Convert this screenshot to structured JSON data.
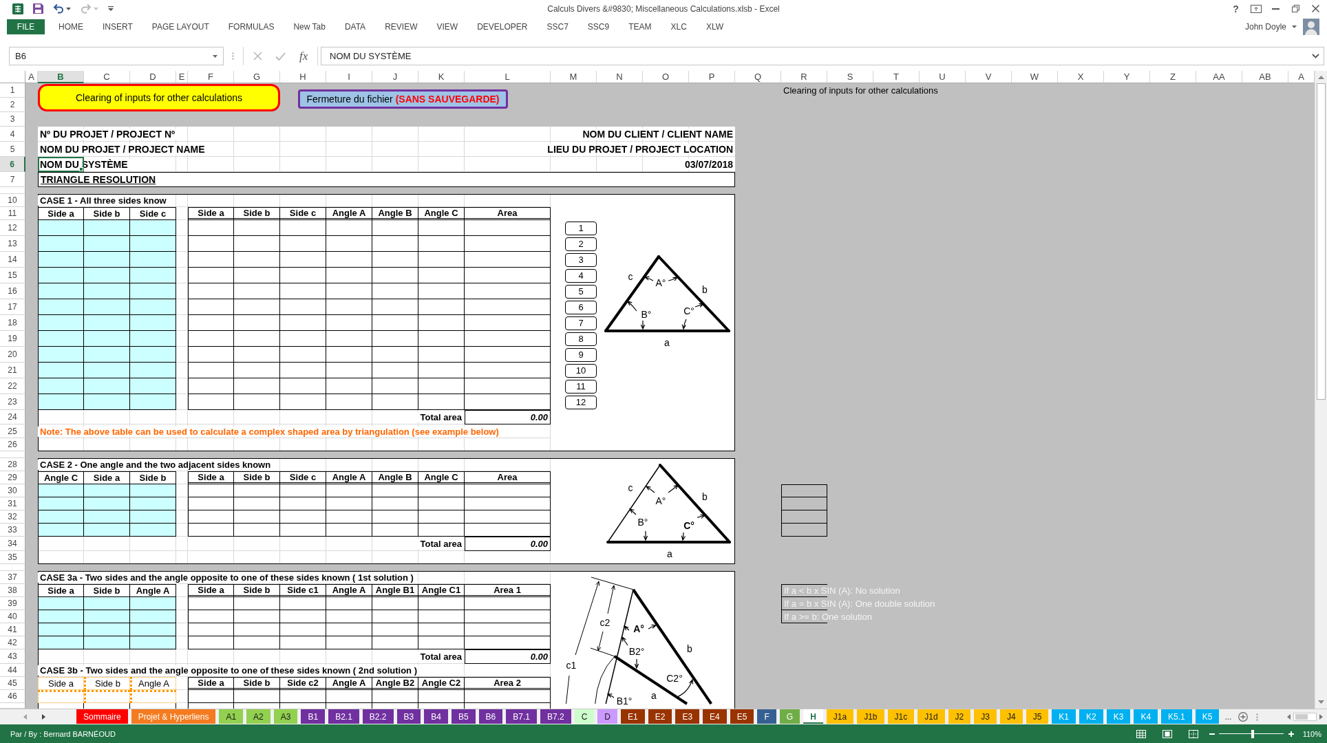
{
  "window": {
    "title": "Calculs Divers &#9830; Miscellaneous Calculations.xlsb - Excel",
    "help": "?",
    "quick_access": [
      {
        "kind": "save",
        "disabled": false
      },
      {
        "kind": "undo",
        "disabled": false
      },
      {
        "kind": "redo",
        "disabled": true
      }
    ]
  },
  "ribbon": {
    "tabs": [
      {
        "label": "FILE",
        "kind": "file",
        "selected": false
      },
      {
        "label": "HOME",
        "kind": "tab",
        "selected": false
      },
      {
        "label": "INSERT",
        "kind": "tab",
        "selected": false
      },
      {
        "label": "PAGE LAYOUT",
        "kind": "tab",
        "selected": false
      },
      {
        "label": "FORMULAS",
        "kind": "tab",
        "selected": false
      },
      {
        "label": "New Tab",
        "kind": "tab",
        "selected": false
      },
      {
        "label": "DATA",
        "kind": "tab",
        "selected": false
      },
      {
        "label": "REVIEW",
        "kind": "tab",
        "selected": false
      },
      {
        "label": "VIEW",
        "kind": "tab",
        "selected": false
      },
      {
        "label": "DEVELOPER",
        "kind": "tab",
        "selected": false
      },
      {
        "label": "SSC7",
        "kind": "tab",
        "selected": false
      },
      {
        "label": "SSC9",
        "kind": "tab",
        "selected": false
      },
      {
        "label": "TEAM",
        "kind": "tab",
        "selected": false
      },
      {
        "label": "XLC",
        "kind": "tab",
        "selected": false
      },
      {
        "label": "XLW",
        "kind": "tab",
        "selected": false
      }
    ],
    "user": {
      "name": "John Doyle"
    }
  },
  "formula_bar": {
    "name_box": "B6",
    "buttons": [
      {
        "kind": "cancel",
        "disabled": true
      },
      {
        "kind": "enter",
        "disabled": true
      },
      {
        "kind": "function",
        "label": "fx",
        "disabled": false
      }
    ],
    "formula": "NOM DU SYSTÈME"
  },
  "sheet": {
    "columns": [
      {
        "label": "A",
        "selected": false
      },
      {
        "label": "B",
        "selected": true
      },
      {
        "label": "C",
        "selected": false
      },
      {
        "label": "D",
        "selected": false
      },
      {
        "label": "E",
        "selected": false
      },
      {
        "label": "F",
        "selected": false
      },
      {
        "label": "G",
        "selected": false
      },
      {
        "label": "H",
        "selected": false
      },
      {
        "label": "I",
        "selected": false
      },
      {
        "label": "J",
        "selected": false
      },
      {
        "label": "K",
        "selected": false
      },
      {
        "label": "L",
        "selected": false
      },
      {
        "label": "M",
        "selected": false
      },
      {
        "label": "N",
        "selected": false
      },
      {
        "label": "O",
        "selected": false
      },
      {
        "label": "P",
        "selected": false
      },
      {
        "label": "Q",
        "selected": false
      },
      {
        "label": "R",
        "selected": false
      },
      {
        "label": "S",
        "selected": false
      },
      {
        "label": "T",
        "selected": false
      },
      {
        "label": "U",
        "selected": false
      },
      {
        "label": "V",
        "selected": false
      },
      {
        "label": "W",
        "selected": false
      },
      {
        "label": "X",
        "selected": false
      },
      {
        "label": "Y",
        "selected": false
      },
      {
        "label": "Z",
        "selected": false
      },
      {
        "label": "AA",
        "selected": false
      },
      {
        "label": "AB",
        "selected": false
      },
      {
        "label": "A",
        "selected": false
      }
    ],
    "sections": [
      {
        "kind": "band",
        "rows": [
          {
            "label": "1",
            "selected": false
          },
          {
            "label": "2",
            "selected": false
          },
          {
            "label": "3",
            "selected": false
          }
        ],
        "buttons": [
          {
            "kind": "clear",
            "label": "Clearing of inputs for other calculations"
          },
          {
            "kind": "close",
            "label": "Fermeture du fichier **(SANS SAUVEGARDE)**"
          }
        ],
        "note": "Clearing of inputs for other calculations"
      },
      {
        "kind": "info",
        "rows": [
          {
            "label": "4",
            "selected": false,
            "left": "Nº DU PROJET / PROJECT Nº",
            "right": "NOM DU CLIENT / CLIENT NAME"
          },
          {
            "label": "5",
            "selected": false,
            "left": "NOM DU PROJET / PROJECT NAME",
            "right": "LIEU DU PROJET / PROJECT LOCATION"
          },
          {
            "label": "6",
            "selected": true,
            "active_cell": true,
            "left": "NOM DU SYSTÈME",
            "right": "03/07/2018"
          },
          {
            "label": "7",
            "selected": false,
            "heading": "TRIANGLE RESOLUTION"
          }
        ]
      },
      {
        "kind": "gap"
      },
      {
        "kind": "case",
        "figure": {
          "kind": "basic",
          "labels": [
            "c",
            "A°",
            "b",
            "B°",
            "C°",
            "a"
          ]
        },
        "rows": [
          {
            "label": "10",
            "selected": false,
            "kind": "title",
            "text": "CASE 1 - All three sides know"
          },
          {
            "label": "11",
            "selected": false,
            "kind": "header",
            "linked": false,
            "inputs": [
              "Side a",
              "Side b",
              "Side c"
            ],
            "outputs": [
              "Side a",
              "Side b",
              "Side c",
              "Angle A",
              "Angle B",
              "Angle C",
              "Area"
            ]
          },
          {
            "label": "12",
            "selected": false,
            "kind": "data",
            "linked": false,
            "button": "1"
          },
          {
            "label": "13",
            "selected": false,
            "kind": "data",
            "linked": false,
            "button": "2"
          },
          {
            "label": "14",
            "selected": false,
            "kind": "data",
            "linked": false,
            "button": "3"
          },
          {
            "label": "15",
            "selected": false,
            "kind": "data",
            "linked": false,
            "button": "4"
          },
          {
            "label": "16",
            "selected": false,
            "kind": "data",
            "linked": false,
            "button": "5"
          },
          {
            "label": "17",
            "selected": false,
            "kind": "data",
            "linked": false,
            "button": "6"
          },
          {
            "label": "18",
            "selected": false,
            "kind": "data",
            "linked": false,
            "button": "7"
          },
          {
            "label": "19",
            "selected": false,
            "kind": "data",
            "linked": false,
            "button": "8"
          },
          {
            "label": "20",
            "selected": false,
            "kind": "data",
            "linked": false,
            "button": "9"
          },
          {
            "label": "21",
            "selected": false,
            "kind": "data",
            "linked": false,
            "button": "10"
          },
          {
            "label": "22",
            "selected": false,
            "kind": "data",
            "linked": false,
            "button": "11"
          },
          {
            "label": "23",
            "selected": false,
            "kind": "data",
            "linked": false,
            "button": "12"
          },
          {
            "label": "24",
            "selected": false,
            "kind": "total",
            "text": "Total area",
            "value": "0.00"
          },
          {
            "label": "25",
            "selected": false,
            "kind": "note",
            "text": "Note: The above table can be used to calculate a complex shaped area by triangulation (see example below)"
          },
          {
            "label": "26",
            "selected": false,
            "kind": "blank"
          }
        ]
      },
      {
        "kind": "gap"
      },
      {
        "kind": "case",
        "figure": {
          "kind": "adjacent",
          "labels": [
            "c",
            "A°",
            "b",
            "B°",
            "C°",
            "a"
          ]
        },
        "rows": [
          {
            "label": "28",
            "selected": false,
            "kind": "title",
            "text": "CASE 2 - One angle and the two adjacent sides known"
          },
          {
            "label": "29",
            "selected": false,
            "kind": "header",
            "linked": false,
            "inputs": [
              "Angle C",
              "Side a",
              "Side b"
            ],
            "outputs": [
              "Side a",
              "Side b",
              "Side c",
              "Angle A",
              "Angle B",
              "Angle C",
              "Area"
            ]
          },
          {
            "label": "30",
            "selected": false,
            "kind": "data",
            "linked": false,
            "side_cell": true
          },
          {
            "label": "31",
            "selected": false,
            "kind": "data",
            "linked": false,
            "side_cell": true
          },
          {
            "label": "32",
            "selected": false,
            "kind": "data",
            "linked": false,
            "side_cell": true
          },
          {
            "label": "33",
            "selected": false,
            "kind": "data",
            "linked": false,
            "side_cell": true
          },
          {
            "label": "34",
            "selected": false,
            "kind": "total",
            "text": "Total area",
            "value": "0.00"
          },
          {
            "label": "35",
            "selected": false,
            "kind": "blank"
          }
        ]
      },
      {
        "kind": "gap"
      },
      {
        "kind": "case",
        "figure": {
          "kind": "ambiguous",
          "labels": [
            "c2",
            "A°",
            "b",
            "B2°",
            "c1",
            "C2°",
            "a",
            "B1°"
          ]
        },
        "rows": [
          {
            "label": "37",
            "selected": false,
            "kind": "title",
            "text": "CASE 3a - Two sides and the angle opposite to one of these sides known ( 1st solution )"
          },
          {
            "label": "38",
            "selected": false,
            "kind": "header",
            "linked": false,
            "inputs": [
              "Side a",
              "Side b",
              "Angle A"
            ],
            "outputs": [
              "Side a",
              "Side b",
              "Side c1",
              "Angle A",
              "Angle B1",
              "Angle C1",
              "Area 1"
            ],
            "side_text": "If a < b x SIN (A): No solution"
          },
          {
            "label": "39",
            "selected": false,
            "kind": "data",
            "linked": false,
            "side_text": "If a = b x SIN (A): One double solution"
          },
          {
            "label": "40",
            "selected": false,
            "kind": "data",
            "linked": false,
            "side_text": "If a >= b: One solution"
          },
          {
            "label": "41",
            "selected": false,
            "kind": "data",
            "linked": false
          },
          {
            "label": "42",
            "selected": false,
            "kind": "data",
            "linked": false
          },
          {
            "label": "43",
            "selected": false,
            "kind": "total",
            "text": "Total area",
            "value": "0.00"
          },
          {
            "label": "44",
            "selected": false,
            "kind": "title",
            "text": "CASE 3b - Two sides and the angle opposite to one of these sides known ( 2nd solution )"
          },
          {
            "label": "45",
            "selected": false,
            "kind": "header",
            "linked": true,
            "inputs": [
              "Side a",
              "Side b",
              "Angle A"
            ],
            "outputs": [
              "Side a",
              "Side b",
              "Side c2",
              "Angle A",
              "Angle B2",
              "Angle C2",
              "Area 2"
            ]
          },
          {
            "label": "46",
            "selected": false,
            "kind": "data",
            "linked": true
          },
          {
            "kind": "partial"
          }
        ]
      }
    ]
  },
  "sheet_tabs": {
    "tabs": [
      {
        "label": "Sommaire",
        "selected": false,
        "color": "#ff0000"
      },
      {
        "label": "Projet & Hyperliens",
        "selected": false,
        "color": "#f47b20"
      },
      {
        "label": "A1",
        "selected": false,
        "color": "#92d050"
      },
      {
        "label": "A2",
        "selected": false,
        "color": "#92d050"
      },
      {
        "label": "A3",
        "selected": false,
        "color": "#92d050"
      },
      {
        "label": "B1",
        "selected": false,
        "color": "#7030a0"
      },
      {
        "label": "B2.1",
        "selected": false,
        "color": "#7030a0"
      },
      {
        "label": "B2.2",
        "selected": false,
        "color": "#7030a0"
      },
      {
        "label": "B3",
        "selected": false,
        "color": "#7030a0"
      },
      {
        "label": "B4",
        "selected": false,
        "color": "#7030a0"
      },
      {
        "label": "B5",
        "selected": false,
        "color": "#7030a0"
      },
      {
        "label": "B6",
        "selected": false,
        "color": "#7030a0"
      },
      {
        "label": "B7.1",
        "selected": false,
        "color": "#7030a0"
      },
      {
        "label": "B7.2",
        "selected": false,
        "color": "#7030a0"
      },
      {
        "label": "C",
        "selected": false,
        "color": "#ccffcc"
      },
      {
        "label": "D",
        "selected": false,
        "color": "#cc99ff"
      },
      {
        "label": "E1",
        "selected": false,
        "color": "#993300"
      },
      {
        "label": "E2",
        "selected": false,
        "color": "#993300"
      },
      {
        "label": "E3",
        "selected": false,
        "color": "#993300"
      },
      {
        "label": "E4",
        "selected": false,
        "color": "#993300"
      },
      {
        "label": "E5",
        "selected": false,
        "color": "#993300"
      },
      {
        "label": "F",
        "selected": false,
        "color": "#366092"
      },
      {
        "label": "G",
        "selected": false,
        "color": "#70ad47"
      },
      {
        "label": "H",
        "selected": true
      },
      {
        "label": "J1a",
        "selected": false,
        "color": "#ffc000"
      },
      {
        "label": "J1b",
        "selected": false,
        "color": "#ffc000"
      },
      {
        "label": "J1c",
        "selected": false,
        "color": "#ffc000"
      },
      {
        "label": "J1d",
        "selected": false,
        "color": "#ffc000"
      },
      {
        "label": "J2",
        "selected": false,
        "color": "#ffc000"
      },
      {
        "label": "J3",
        "selected": false,
        "color": "#ffc000"
      },
      {
        "label": "J4",
        "selected": false,
        "color": "#ffc000"
      },
      {
        "label": "J5",
        "selected": false,
        "color": "#ffc000"
      },
      {
        "label": "K1",
        "selected": false,
        "color": "#00b0f0"
      },
      {
        "label": "K2",
        "selected": false,
        "color": "#00b0f0"
      },
      {
        "label": "K3",
        "selected": false,
        "color": "#00b0f0"
      },
      {
        "label": "K4",
        "selected": false,
        "color": "#00b0f0"
      },
      {
        "label": "K5.1",
        "selected": false,
        "color": "#00b0f0"
      },
      {
        "label": "K5",
        "selected": false,
        "color": "#00b0f0"
      }
    ],
    "more": "..."
  },
  "status_bar": {
    "text": "Par / By : Bernard BARNÉOUD",
    "zoom": {
      "level": 0.52,
      "reading": "110%"
    }
  }
}
